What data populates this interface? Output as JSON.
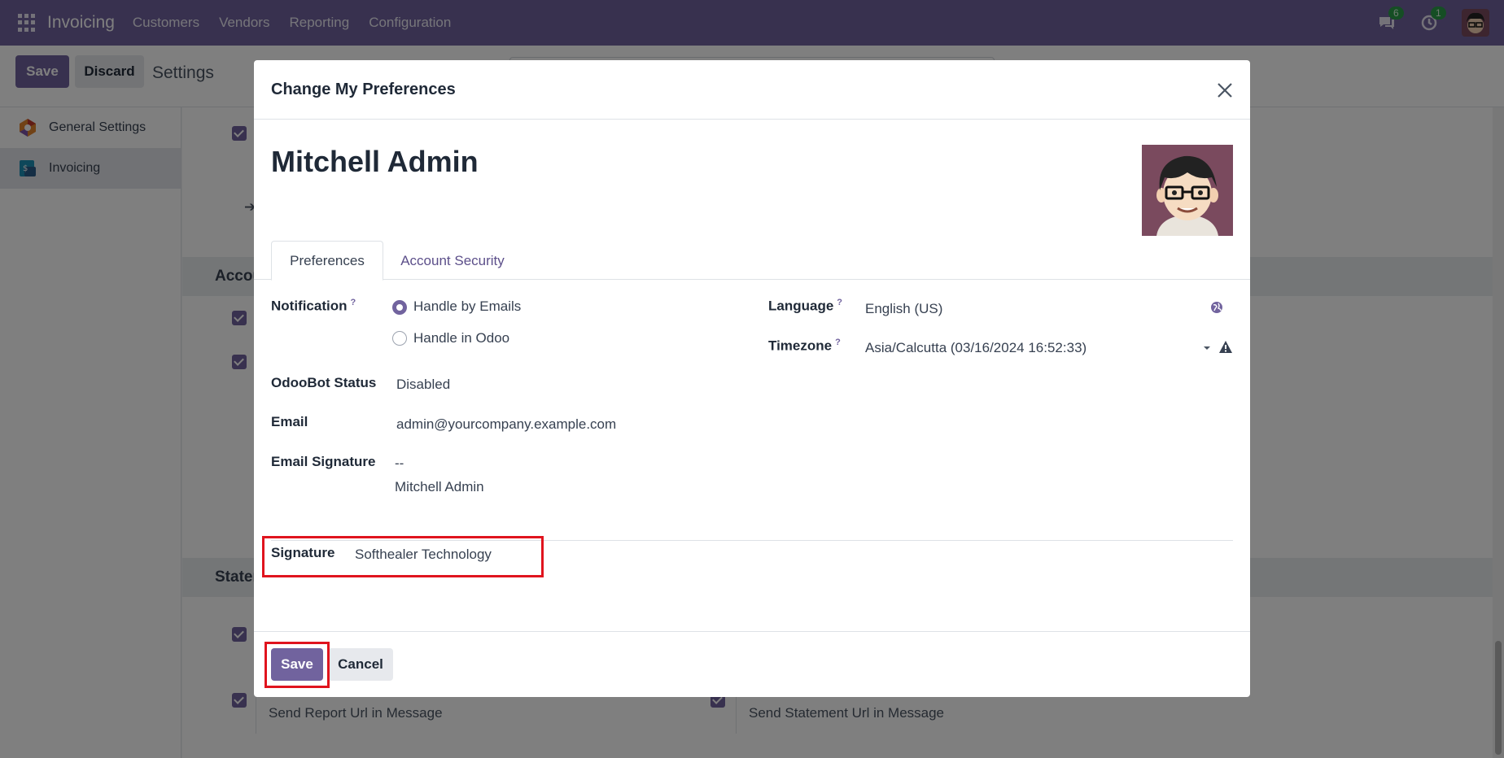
{
  "navbar": {
    "brand": "Invoicing",
    "menu": [
      "Customers",
      "Vendors",
      "Reporting",
      "Configuration"
    ],
    "messages_badge": "6",
    "activity_badge": "1"
  },
  "control_panel": {
    "save_label": "Save",
    "discard_label": "Discard",
    "title": "Settings"
  },
  "sidebar": {
    "items": [
      {
        "label": "General Settings",
        "icon": "general-settings-icon",
        "active": false
      },
      {
        "label": "Invoicing",
        "icon": "invoicing-app-icon",
        "active": true
      }
    ]
  },
  "background": {
    "section_accounting": "Accou",
    "section_statements": "Staten",
    "report_url_label": "Send Report Url in Message",
    "statement_url_label": "Send Statement Url in Message"
  },
  "modal": {
    "title": "Change My Preferences",
    "user_name": "Mitchell Admin",
    "tabs": [
      "Preferences",
      "Account Security"
    ],
    "notification": {
      "label": "Notification",
      "help": "?",
      "options": [
        "Handle by Emails",
        "Handle in Odoo"
      ],
      "selected": "Handle by Emails"
    },
    "odoobot": {
      "label": "OdooBot Status",
      "value": "Disabled"
    },
    "email": {
      "label": "Email",
      "value": "admin@yourcompany.example.com"
    },
    "email_signature": {
      "label": "Email Signature",
      "line1": "--",
      "line2": "Mitchell Admin"
    },
    "language": {
      "label": "Language",
      "help": "?",
      "value": "English (US)"
    },
    "timezone": {
      "label": "Timezone",
      "help": "?",
      "value": "Asia/Calcutta (03/16/2024 16:52:33)"
    },
    "signature": {
      "label": "Signature",
      "value": "Softhealer Technology"
    },
    "footer": {
      "save_label": "Save",
      "cancel_label": "Cancel"
    }
  },
  "colors": {
    "brand": "#71639e",
    "highlight": "#e0141e"
  }
}
